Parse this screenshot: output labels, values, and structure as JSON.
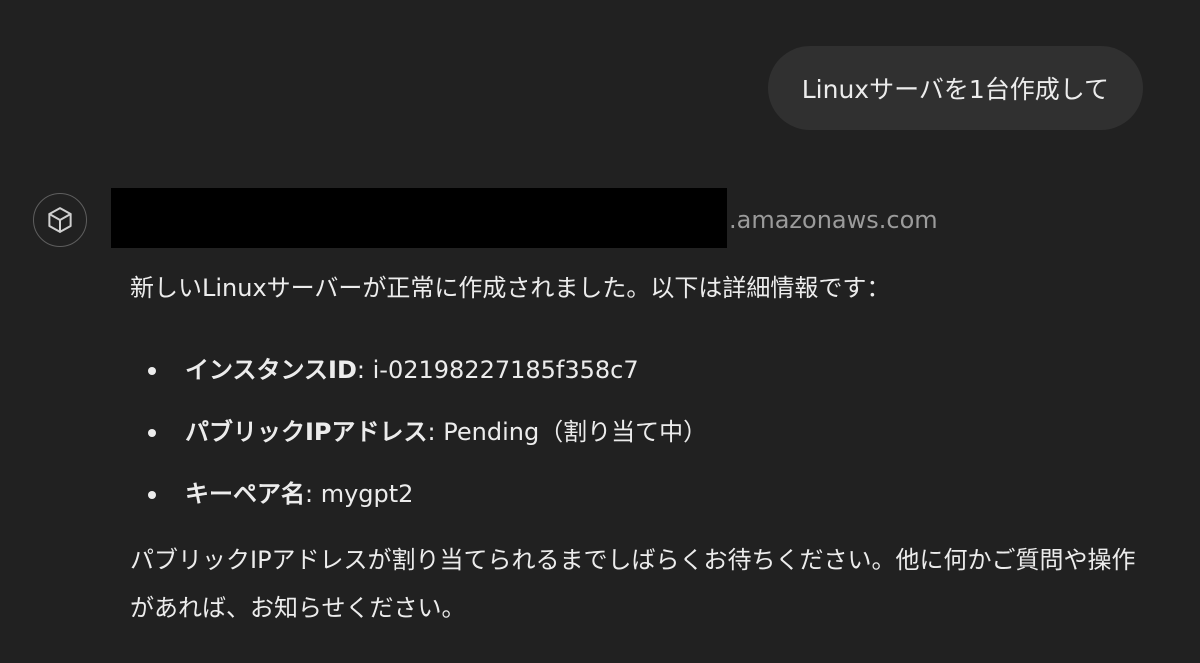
{
  "user_message": {
    "text": "Linuxサーバを1台作成して"
  },
  "assistant": {
    "avatar_icon": "cube-icon",
    "tool_call": {
      "domain_suffix": ".amazonaws.com"
    },
    "intro": "新しいLinuxサーバーが正常に作成されました。以下は詳細情報です：",
    "details": [
      {
        "key": "インスタンスID",
        "value": ": i-02198227185f358c7"
      },
      {
        "key": "パブリックIPアドレス",
        "value": ": Pending（割り当て中）"
      },
      {
        "key": "キーペア名",
        "value": ": mygpt2"
      }
    ],
    "closing": "パブリックIPアドレスが割り当てられるまでしばらくお待ちください。他に何かご質問や操作があれば、お知らせください。"
  },
  "colors": {
    "background": "#212121",
    "user_bubble": "#303030",
    "text": "#ececec",
    "muted_text": "#9b9b9b",
    "redaction": "#000000"
  }
}
